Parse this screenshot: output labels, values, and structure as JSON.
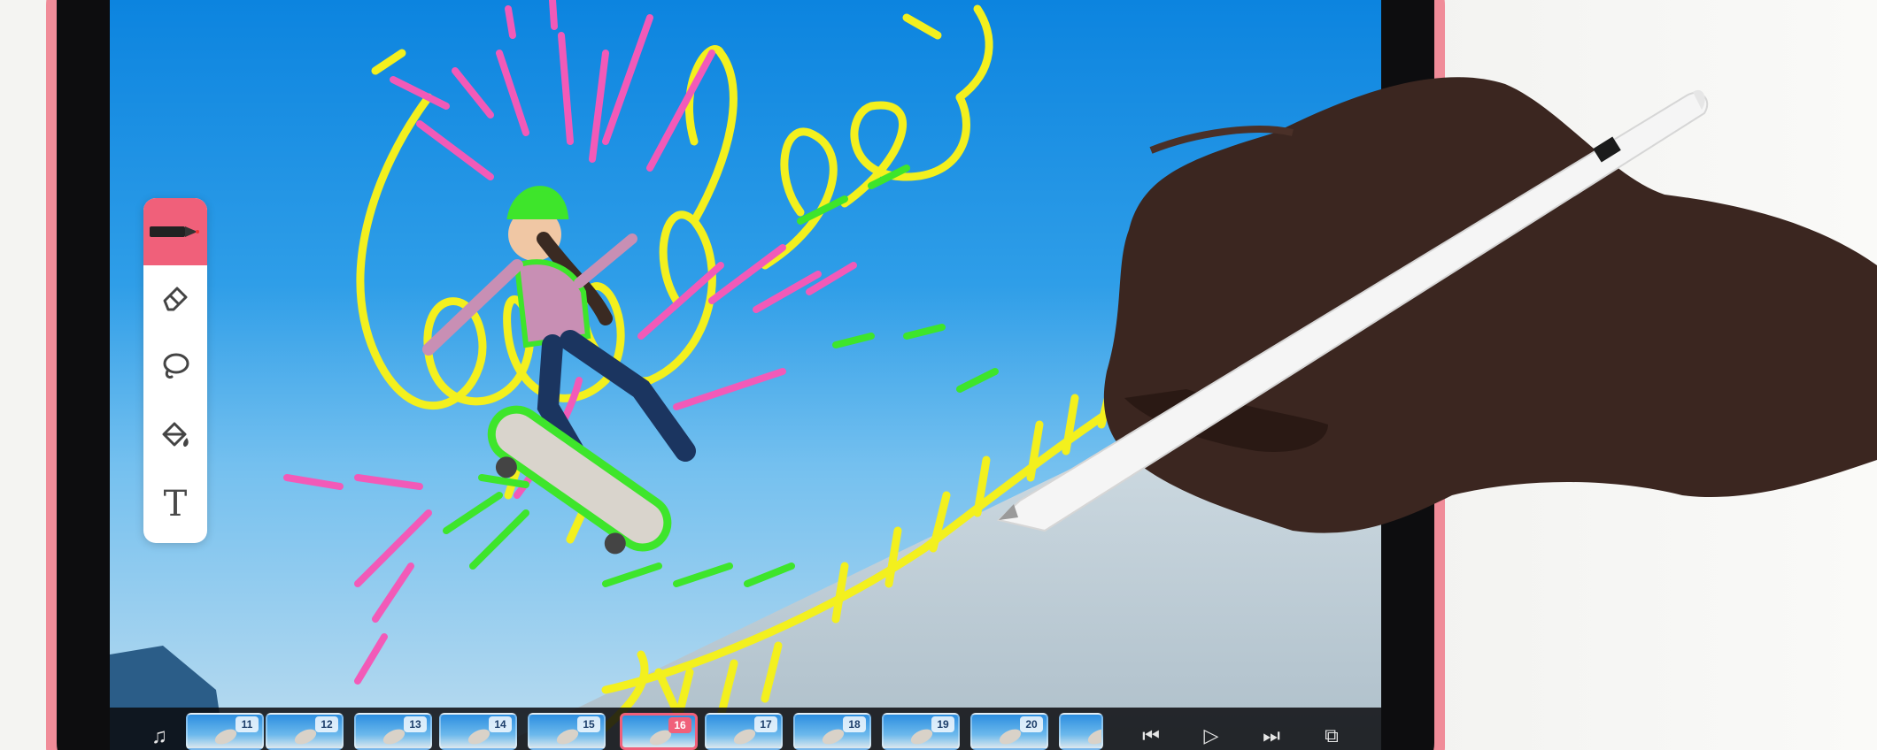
{
  "colors": {
    "ipad_frame": "#f08c99",
    "bezel": "#0d0d0f",
    "tool_active": "#f0607a",
    "doodle_yellow": "#f3f01e",
    "doodle_pink": "#f25ab8",
    "doodle_green": "#3ee52b"
  },
  "tools": [
    {
      "name": "pen",
      "icon": "pen-icon",
      "active": true
    },
    {
      "name": "eraser",
      "icon": "eraser-icon",
      "active": false
    },
    {
      "name": "lasso",
      "icon": "lasso-icon",
      "active": false
    },
    {
      "name": "fill",
      "icon": "paint-bucket-icon",
      "active": false
    },
    {
      "name": "text",
      "icon": "text-icon",
      "glyph": "T",
      "active": false
    }
  ],
  "timeline": {
    "frames": [
      "11",
      "12",
      "13",
      "14",
      "15",
      "16",
      "17",
      "18",
      "19",
      "20"
    ],
    "selected_frame": "16",
    "controls": [
      "music-icon",
      "skip-back-icon",
      "play-icon",
      "skip-forward-icon",
      "add-layer-icon"
    ]
  }
}
